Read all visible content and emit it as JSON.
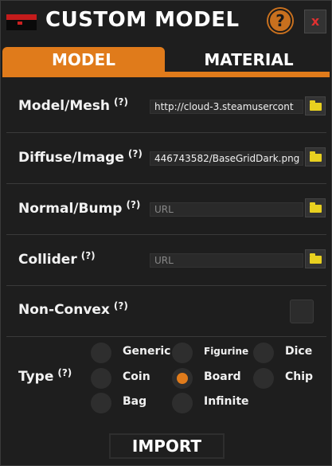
{
  "window": {
    "title": "CUSTOM MODEL",
    "help_icon": "?",
    "close_icon": "x"
  },
  "tabs": [
    {
      "label": "MODEL",
      "active": true
    },
    {
      "label": "MATERIAL",
      "active": false
    }
  ],
  "fields": {
    "model_mesh": {
      "label": "Model/Mesh",
      "help": "(?)",
      "value": "http://cloud-3.steamusercont",
      "placeholder": "URL"
    },
    "diffuse": {
      "label": "Diffuse/Image",
      "help": "(?)",
      "value": "446743582/BaseGridDark.png",
      "placeholder": "URL"
    },
    "normal": {
      "label": "Normal/Bump",
      "help": "(?)",
      "value": "",
      "placeholder": "URL"
    },
    "collider": {
      "label": "Collider",
      "help": "(?)",
      "value": "",
      "placeholder": "URL"
    }
  },
  "nonconvex": {
    "label": "Non-Convex",
    "help": "(?)",
    "checked": false
  },
  "type": {
    "label": "Type",
    "help": "(?)",
    "selected": "Board",
    "options": [
      "Generic",
      "Figurine",
      "Dice",
      "Coin",
      "Board",
      "Chip",
      "Bag",
      "Infinite"
    ]
  },
  "import_label": "IMPORT",
  "colors": {
    "accent": "#e07b1b",
    "background": "#1e1e1e",
    "folder": "#e8d020"
  }
}
